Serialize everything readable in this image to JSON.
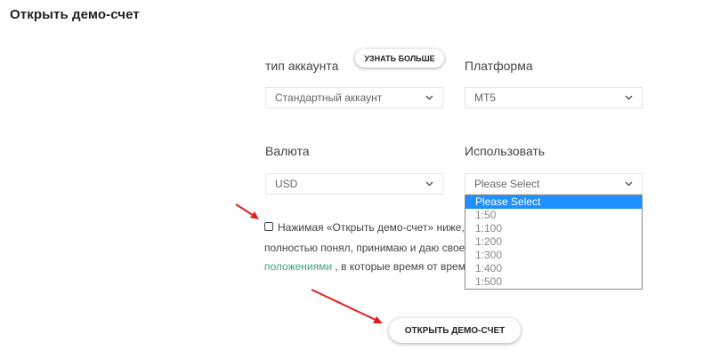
{
  "page": {
    "title": "Открыть демо-счет"
  },
  "account_type": {
    "label": "тип аккаунта",
    "learn_more_label": "УЗНАТЬ БОЛЬШЕ",
    "selected": "Стандартный аккаунт"
  },
  "platform": {
    "label": "Платформа",
    "selected": "MT5"
  },
  "currency": {
    "label": "Валюта",
    "selected": "USD"
  },
  "leverage": {
    "label": "Использовать",
    "selected": "Please Select",
    "options": [
      "Please Select",
      "1:50",
      "1:100",
      "1:200",
      "1:300",
      "1:400",
      "1:500"
    ]
  },
  "consent": {
    "line1": "Нажимая «Открыть демо-счет» ниже,",
    "line2": "полностью понял, принимаю и даю свое",
    "link_text": "положениями",
    "line3_rest": " , в которые время от врем"
  },
  "submit": {
    "label": "ОТКРЫТЬ ДЕМО-СЧЕТ"
  },
  "colors": {
    "link": "#3aa57a",
    "arrow": "#e02020",
    "dropdown_highlight": "#1e90ff"
  }
}
